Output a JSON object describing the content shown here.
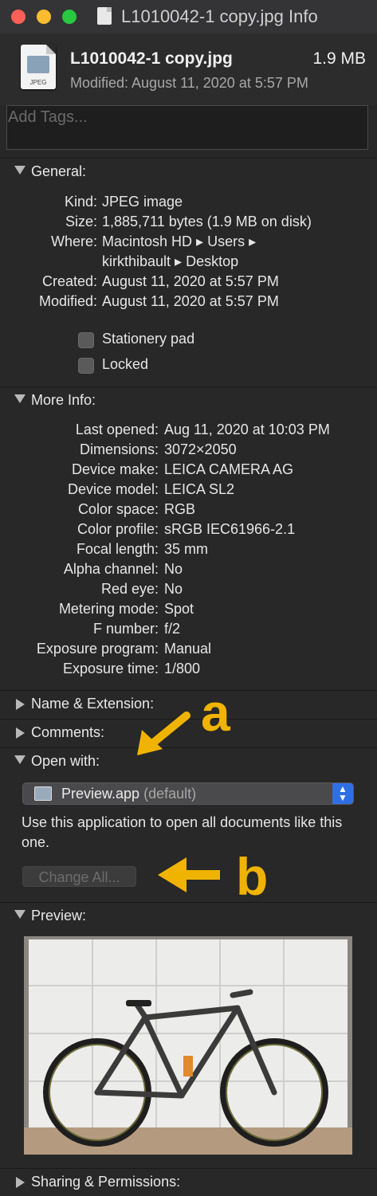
{
  "window": {
    "title": "L1010042-1 copy.jpg Info"
  },
  "file": {
    "name": "L1010042-1 copy.jpg",
    "size": "1.9 MB",
    "modified": "Modified: August 11, 2020 at 5:57 PM",
    "icon_label": "JPEG"
  },
  "tags": {
    "placeholder": "Add Tags..."
  },
  "general": {
    "header": "General:",
    "rows": [
      {
        "key": "Kind:",
        "value": "JPEG image"
      },
      {
        "key": "Size:",
        "value": "1,885,711 bytes (1.9 MB on disk)"
      },
      {
        "key": "Where:",
        "value": "Macintosh HD ▸ Users ▸"
      },
      {
        "key": "",
        "value": "kirkthibault ▸ Desktop"
      },
      {
        "key": "Created:",
        "value": "August 11, 2020 at 5:57 PM"
      },
      {
        "key": "Modified:",
        "value": "August 11, 2020 at 5:57 PM"
      }
    ],
    "stationery": "Stationery pad",
    "locked": "Locked"
  },
  "more_info": {
    "header": "More Info:",
    "rows": [
      {
        "key": "Last opened:",
        "value": "Aug 11, 2020 at 10:03 PM"
      },
      {
        "key": "Dimensions:",
        "value": "3072×2050"
      },
      {
        "key": "Device make:",
        "value": "LEICA CAMERA AG"
      },
      {
        "key": "Device model:",
        "value": "LEICA SL2"
      },
      {
        "key": "Color space:",
        "value": "RGB"
      },
      {
        "key": "Color profile:",
        "value": "sRGB IEC61966-2.1"
      },
      {
        "key": "Focal length:",
        "value": "35 mm"
      },
      {
        "key": "Alpha channel:",
        "value": "No"
      },
      {
        "key": "Red eye:",
        "value": "No"
      },
      {
        "key": "Metering mode:",
        "value": "Spot"
      },
      {
        "key": "F number:",
        "value": "f/2"
      },
      {
        "key": "Exposure program:",
        "value": "Manual"
      },
      {
        "key": "Exposure time:",
        "value": "1/800"
      }
    ]
  },
  "name_ext": {
    "header": "Name & Extension:"
  },
  "comments": {
    "header": "Comments:"
  },
  "open_with": {
    "header": "Open with:",
    "app": "Preview.app",
    "default_tag": "(default)",
    "description": "Use this application to open all documents like this one.",
    "change_all": "Change All..."
  },
  "preview": {
    "header": "Preview:"
  },
  "sharing": {
    "header": "Sharing & Permissions:"
  },
  "annotations": {
    "a": "a",
    "b": "b"
  },
  "colors": {
    "accent": "#2f6fe4",
    "annotation": "#f0b400"
  }
}
